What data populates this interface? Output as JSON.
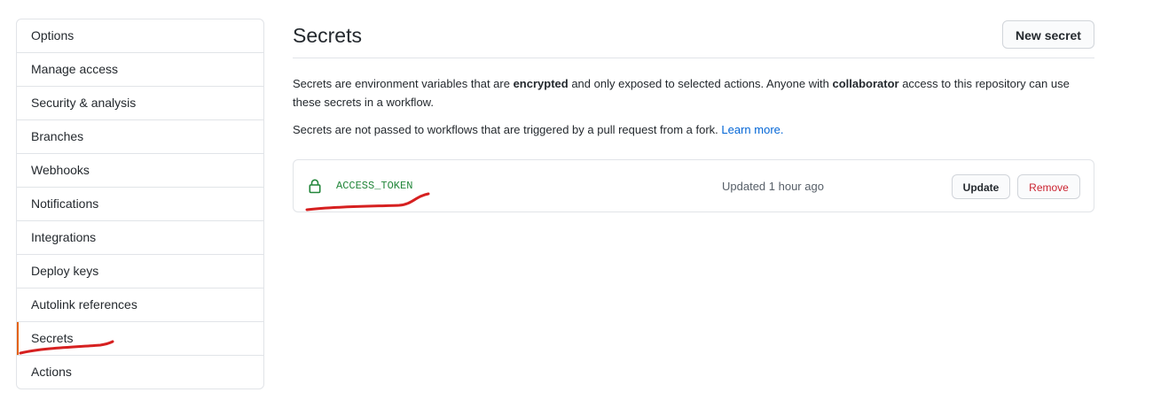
{
  "sidebar": {
    "items": [
      {
        "label": "Options"
      },
      {
        "label": "Manage access"
      },
      {
        "label": "Security & analysis"
      },
      {
        "label": "Branches"
      },
      {
        "label": "Webhooks"
      },
      {
        "label": "Notifications"
      },
      {
        "label": "Integrations"
      },
      {
        "label": "Deploy keys"
      },
      {
        "label": "Autolink references"
      },
      {
        "label": "Secrets",
        "selected": true
      },
      {
        "label": "Actions"
      }
    ]
  },
  "header": {
    "title": "Secrets",
    "new_secret_label": "New secret"
  },
  "description": {
    "p1_part1": "Secrets are environment variables that are ",
    "p1_bold1": "encrypted",
    "p1_part2": " and only exposed to selected actions. Anyone with ",
    "p1_bold2": "collaborator",
    "p1_part3": " access to this repository can use these secrets in a workflow.",
    "p2_text": "Secrets are not passed to workflows that are triggered by a pull request from a fork. ",
    "p2_link": "Learn more."
  },
  "secrets": [
    {
      "name": "ACCESS_TOKEN",
      "updated": "Updated 1 hour ago",
      "update_label": "Update",
      "remove_label": "Remove"
    }
  ],
  "colors": {
    "selected_accent": "#e36209",
    "secret_name": "#22863a",
    "link": "#0366d6",
    "remove": "#cb2431",
    "annotation": "#d62020"
  },
  "icons": {
    "secret_icon": "lock-icon"
  }
}
